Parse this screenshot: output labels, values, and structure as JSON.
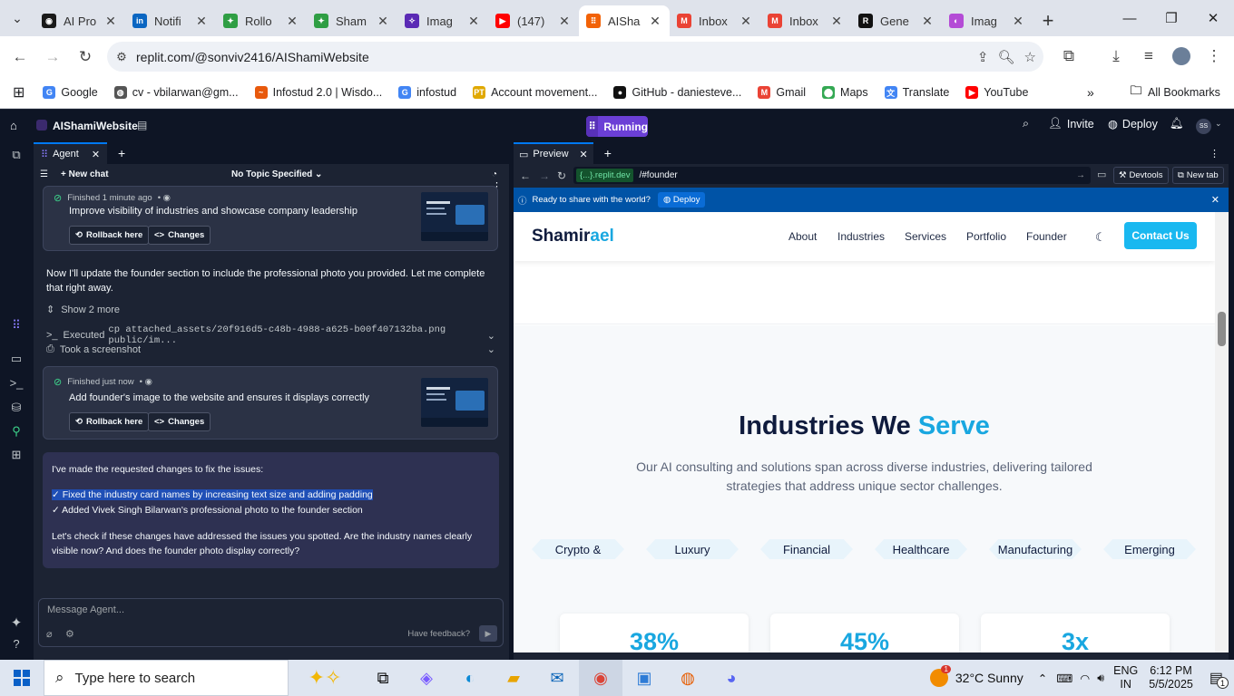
{
  "browser": {
    "tabs": [
      {
        "label": "AI Pro",
        "color": "#1a1a1a",
        "glyph": "◉"
      },
      {
        "label": "Notifi",
        "color": "#0a66c2",
        "glyph": "in"
      },
      {
        "label": "Rollo",
        "color": "#2f9e44",
        "glyph": "✦"
      },
      {
        "label": "Sham",
        "color": "#2f9e44",
        "glyph": "✦"
      },
      {
        "label": "Imag",
        "color": "#5b2ab5",
        "glyph": "✧"
      },
      {
        "label": "(147)",
        "color": "#ff0000",
        "glyph": "▶"
      },
      {
        "label": "AISha",
        "color": "#f26207",
        "glyph": "⠿"
      },
      {
        "label": "Inbox",
        "color": "#ea4335",
        "glyph": "M"
      },
      {
        "label": "Inbox",
        "color": "#ea4335",
        "glyph": "M"
      },
      {
        "label": "Gene",
        "color": "#111111",
        "glyph": "R"
      },
      {
        "label": "Imag",
        "color": "#b44bd6",
        "glyph": "◐"
      }
    ],
    "url": "replit.com/@sonviv2416/AIShamiWebsite",
    "bookmarks": [
      {
        "label": "Google",
        "color": "#4285f4",
        "glyph": "G"
      },
      {
        "label": "cv - vbilarwan@gm...",
        "color": "#555555",
        "glyph": "◍"
      },
      {
        "label": "Infostud 2.0 | Wisdo...",
        "color": "#e8590c",
        "glyph": "~"
      },
      {
        "label": "infostud",
        "color": "#4285f4",
        "glyph": "G"
      },
      {
        "label": "Account movement...",
        "color": "#e0a800",
        "glyph": "PT"
      },
      {
        "label": "GitHub - daniesteve...",
        "color": "#111111",
        "glyph": "●"
      },
      {
        "label": "Gmail",
        "color": "#ea4335",
        "glyph": "M"
      },
      {
        "label": "Maps",
        "color": "#34a853",
        "glyph": "⬤"
      },
      {
        "label": "Translate",
        "color": "#4285f4",
        "glyph": "文"
      },
      {
        "label": "YouTube",
        "color": "#ff0000",
        "glyph": "▶"
      }
    ],
    "all_bookmarks": "All Bookmarks"
  },
  "replit": {
    "project": "AIShamiWebsite",
    "run_label": "Running",
    "invite_label": "Invite",
    "deploy_label": "Deploy",
    "avatar": "SS"
  },
  "agent": {
    "tab_label": "Agent",
    "new_chat": "New chat",
    "topic": "No Topic Specified",
    "checkpoint1": {
      "status": "Finished 1 minute ago",
      "title": "Improve visibility of industries and showcase company leadership",
      "rollback": "Rollback here",
      "changes": "Changes"
    },
    "message1": "Now I'll update the founder section to include the professional photo you provided. Let me complete that right away.",
    "show_more": "Show 2 more",
    "executed_prefix": "Executed",
    "executed_cmd": "cp attached_assets/20f916d5-c48b-4988-a625-b00f407132ba.png public/im...",
    "screenshot": "Took a screenshot",
    "checkpoint2": {
      "status": "Finished just now",
      "title": "Add founder's image to the website and ensures it displays correctly",
      "rollback": "Rollback here",
      "changes": "Changes"
    },
    "summary": {
      "intro": "I've made the requested changes to fix the issues:",
      "item1": "✓ Fixed the industry card names by increasing text size and adding padding",
      "item2": "✓ Added Vivek Singh Bilarwan's professional photo to the founder section",
      "outro": "Let's check if these changes have addressed the issues you spotted. Are the industry names clearly visible now? And does the founder photo display correctly?"
    },
    "input_placeholder": "Message Agent...",
    "feedback": "Have feedback?"
  },
  "preview": {
    "tab_label": "Preview",
    "domain": "{...}.replit.dev",
    "path": "/#founder",
    "devtools": "Devtools",
    "new_tab": "New tab",
    "share_text": "Ready to share with the world?",
    "share_deploy": "Deploy"
  },
  "site": {
    "logo_main": "Shamir",
    "logo_accent": "ael",
    "nav": [
      "About",
      "Industries",
      "Services",
      "Portfolio",
      "Founder"
    ],
    "contact": "Contact Us",
    "title_main": "Industries We",
    "title_accent": "Serve",
    "subtitle": "Our AI consulting and solutions span across diverse industries, delivering tailored strategies that address unique sector challenges.",
    "industries": [
      "Crypto &",
      "Luxury",
      "Financial",
      "Healthcare",
      "Manufacturing",
      "Emerging"
    ],
    "stats": [
      "38%",
      "45%",
      "3x"
    ]
  },
  "taskbar": {
    "search_placeholder": "Type here to search",
    "weather": "32°C  Sunny",
    "lang1": "ENG",
    "lang2": "IN",
    "time": "6:12 PM",
    "date": "5/5/2025",
    "notif_count": "1",
    "weather_badge": "1"
  }
}
